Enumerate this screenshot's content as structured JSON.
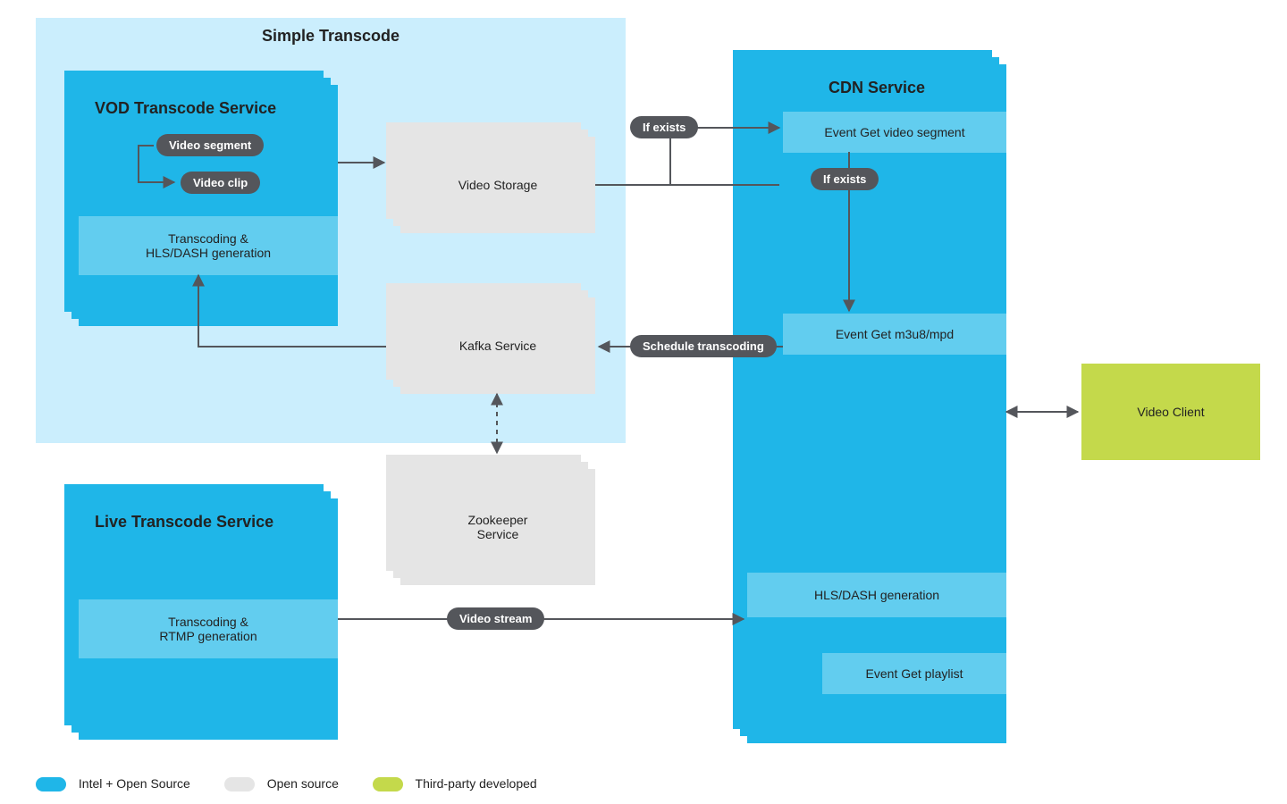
{
  "region_title": "Simple Transcode",
  "vod": {
    "title": "VOD Transcode Service",
    "pill_segment": "Video segment",
    "pill_clip": "Video clip",
    "task": "Transcoding &\nHLS/DASH generation"
  },
  "live": {
    "title": "Live Transcode Service",
    "task": "Transcoding &\nRTMP generation"
  },
  "storage": "Video Storage",
  "kafka": "Kafka Service",
  "zookeeper": "Zookeeper\nService",
  "cdn": {
    "title": "CDN Service",
    "ev_segment": "Event Get video segment",
    "ev_m3u8": "Event Get m3u8/mpd",
    "hls": "HLS/DASH generation",
    "ev_playlist": "Event Get playlist"
  },
  "client": "Video Client",
  "pill_if_exists_1": "If exists",
  "pill_if_exists_2": "If exists",
  "pill_schedule": "Schedule transcoding",
  "pill_stream": "Video stream",
  "legend": {
    "intel": "Intel + Open Source",
    "open": "Open source",
    "third": "Third-party developed"
  },
  "colors": {
    "blue": "#1fb6e8",
    "gray": "#e5e5e5",
    "green": "#c4d94b"
  }
}
